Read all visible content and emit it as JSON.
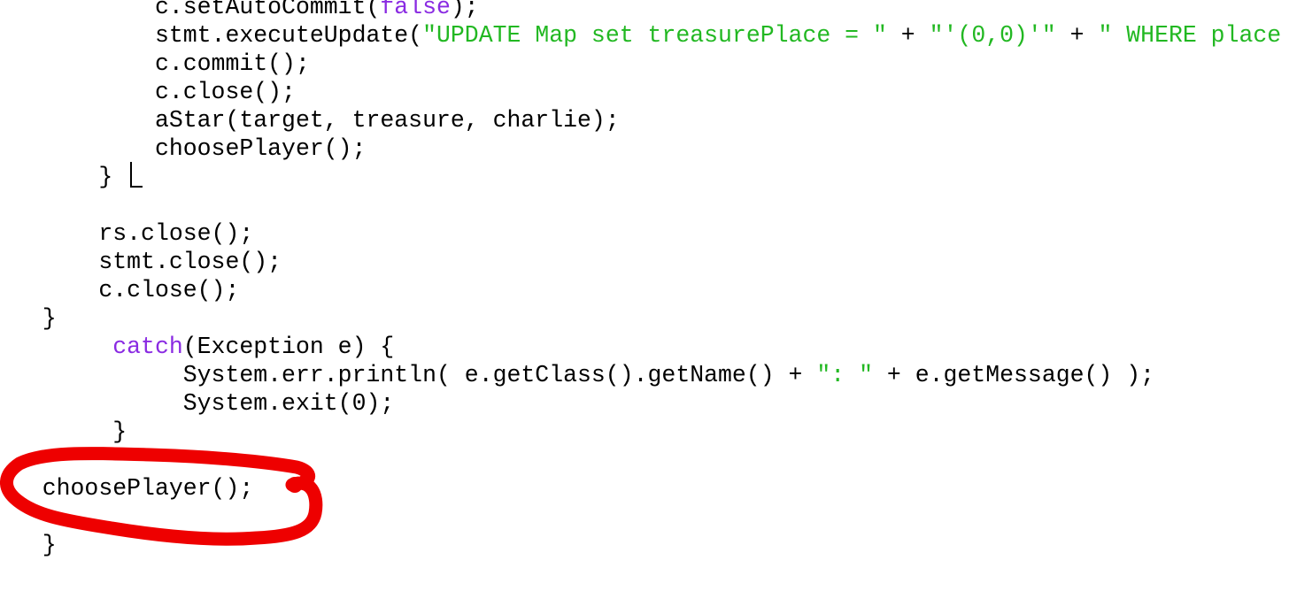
{
  "code_lines": [
    {
      "indent": "           ",
      "segments": [
        {
          "text": "c.setAutoCommit(",
          "kind": "plain"
        },
        {
          "text": "false",
          "kind": "keyword"
        },
        {
          "text": ");",
          "kind": "plain"
        }
      ]
    },
    {
      "indent": "           ",
      "segments": [
        {
          "text": "stmt.executeUpdate(",
          "kind": "plain"
        },
        {
          "text": "\"UPDATE Map set treasurePlace = \"",
          "kind": "string"
        },
        {
          "text": " + ",
          "kind": "plain"
        },
        {
          "text": "\"'(0,0)'\"",
          "kind": "string"
        },
        {
          "text": " + ",
          "kind": "plain"
        },
        {
          "text": "\" WHERE place",
          "kind": "string"
        }
      ]
    },
    {
      "indent": "           ",
      "segments": [
        {
          "text": "c.commit();",
          "kind": "plain"
        }
      ]
    },
    {
      "indent": "           ",
      "segments": [
        {
          "text": "c.close();",
          "kind": "plain"
        }
      ]
    },
    {
      "indent": "           ",
      "segments": [
        {
          "text": "aStar(target, treasure, charlie);",
          "kind": "plain"
        }
      ]
    },
    {
      "indent": "           ",
      "segments": [
        {
          "text": "choosePlayer();",
          "kind": "plain"
        }
      ]
    },
    {
      "indent": "       ",
      "segments": [
        {
          "text": "}",
          "kind": "plain"
        }
      ]
    },
    {
      "indent": "",
      "segments": []
    },
    {
      "indent": "       ",
      "segments": [
        {
          "text": "rs.close();",
          "kind": "plain"
        }
      ]
    },
    {
      "indent": "       ",
      "segments": [
        {
          "text": "stmt.close();",
          "kind": "plain"
        }
      ]
    },
    {
      "indent": "       ",
      "segments": [
        {
          "text": "c.close();",
          "kind": "plain"
        }
      ]
    },
    {
      "indent": "   ",
      "segments": [
        {
          "text": "}",
          "kind": "plain"
        }
      ]
    },
    {
      "indent": "        ",
      "segments": [
        {
          "text": "catch",
          "kind": "keyword"
        },
        {
          "text": "(Exception e) {",
          "kind": "plain"
        }
      ]
    },
    {
      "indent": "             ",
      "segments": [
        {
          "text": "System.err.println( e.getClass().getName() + ",
          "kind": "plain"
        },
        {
          "text": "\": \"",
          "kind": "string"
        },
        {
          "text": " + e.getMessage() );",
          "kind": "plain"
        }
      ]
    },
    {
      "indent": "             ",
      "segments": [
        {
          "text": "System.exit(0);",
          "kind": "plain"
        }
      ]
    },
    {
      "indent": "        ",
      "segments": [
        {
          "text": "}",
          "kind": "plain"
        }
      ]
    },
    {
      "indent": "",
      "segments": []
    },
    {
      "indent": "   ",
      "segments": [
        {
          "text": "choosePlayer();",
          "kind": "plain"
        }
      ]
    },
    {
      "indent": "",
      "segments": []
    },
    {
      "indent": "   ",
      "segments": [
        {
          "text": "}",
          "kind": "plain"
        }
      ]
    }
  ],
  "colors": {
    "text": "#000000",
    "keyword": "#8a2be2",
    "string": "#22b822",
    "annotation_circle": "#ee0000",
    "background": "#ffffff"
  },
  "annotation": {
    "shape": "hand-drawn circle",
    "target_line_text": "choosePlayer();"
  }
}
